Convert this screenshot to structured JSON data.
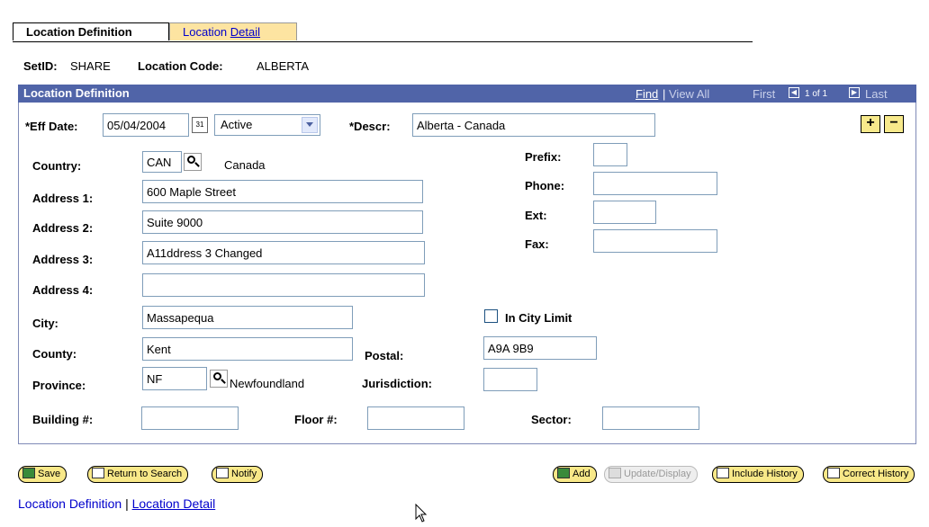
{
  "tabs": [
    {
      "label": "Location Definition",
      "active": true
    },
    {
      "label_prefix": "Location ",
      "label_accel": "Detail",
      "active": false
    }
  ],
  "header": {
    "setid_label": "SetID:",
    "setid_value": "SHARE",
    "location_code_label": "Location Code:",
    "location_code_value": "ALBERTA"
  },
  "section": {
    "title": "Location Definition",
    "find": "Find",
    "nav_sep": "|",
    "view_all": "View All",
    "first": "First",
    "count": "1 of 1",
    "last": "Last"
  },
  "form": {
    "eff_date_label": "*Eff Date:",
    "eff_date_value": "05/04/2004",
    "status_value": "Active",
    "descr_label": "*Descr:",
    "descr_value": "Alberta - Canada",
    "add_row": "+",
    "delete_row": "−",
    "country_label": "Country:",
    "country_value": "CAN",
    "country_name": "Canada",
    "address1_label": "Address 1:",
    "address1_value": "600 Maple Street",
    "address2_label": "Address 2:",
    "address2_value": "Suite 9000",
    "address3_label": "Address 3:",
    "address3_value": "A11ddress 3 Changed",
    "address4_label": "Address 4:",
    "address4_value": "",
    "city_label": "City:",
    "city_value": "Massapequa",
    "county_label": "County:",
    "county_value": "Kent",
    "province_label": "Province:",
    "province_value": "NF",
    "province_name": "Newfoundland",
    "building_label": "Building #:",
    "building_value": "",
    "floor_label": "Floor #:",
    "floor_value": "",
    "sector_label": "Sector:",
    "sector_value": "",
    "prefix_label": "Prefix:",
    "prefix_value": "",
    "phone_label": "Phone:",
    "phone_value": "",
    "ext_label": "Ext:",
    "ext_value": "",
    "fax_label": "Fax:",
    "fax_value": "",
    "in_city_limit_label": "In City Limit",
    "in_city_limit_checked": false,
    "postal_label": "Postal:",
    "postal_value": "A9A 9B9",
    "jurisdiction_label": "Jurisdiction:",
    "jurisdiction_value": ""
  },
  "buttons": {
    "save": "Save",
    "return_to_search": "Return to Search",
    "notify": "Notify",
    "add": "Add",
    "update_display": "Update/Display",
    "include_history": "Include History",
    "correct_history": "Correct History"
  },
  "footer": {
    "link1": "Location Definition",
    "sep": "|",
    "link2": "Location Detail"
  },
  "colors": {
    "section_bar": "#5064a8",
    "button_yellow": "#f8e888",
    "link_blue": "#0000cc",
    "inactive_tab": "#fde4a1"
  }
}
